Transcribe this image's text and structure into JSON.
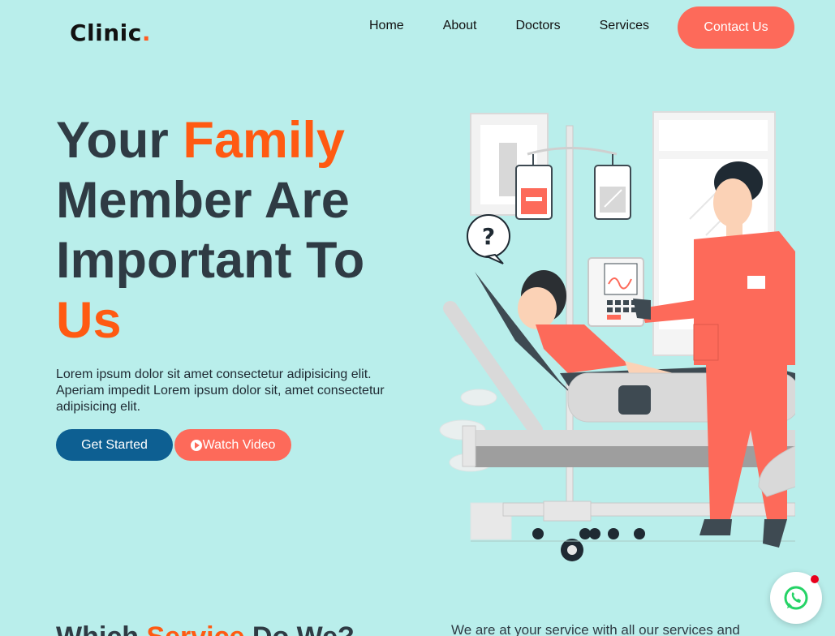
{
  "header": {
    "logo_text": "Clinic",
    "logo_dot": ".",
    "nav": [
      "Home",
      "About",
      "Doctors",
      "Services"
    ],
    "contact_label": "Contact Us"
  },
  "hero": {
    "title_line1_a": "Your ",
    "title_line1_b": "Family",
    "title_line2": "Member Are",
    "title_line3": "Important To",
    "title_line4": "Us",
    "text": "Lorem ipsum dolor sit amet consectetur adipisicing elit. Aperiam impedit Lorem ipsum dolor sit, amet consectetur adipisicing elit.",
    "start_label": "Get Started",
    "video_label": "Watch Video",
    "bubble_text": "?"
  },
  "section": {
    "title_a": "Which ",
    "title_b": "Service",
    "title_c": " Do We?",
    "text": "We are at your service with all our services and"
  },
  "colors": {
    "background": "#b9eeeb",
    "accent": "#ff5a12",
    "coral": "#fd6a5a",
    "primary": "#0d5f92",
    "whatsapp": "#25d366"
  },
  "icons": [
    "play-icon",
    "whatsapp-icon",
    "question-bubble-icon"
  ]
}
